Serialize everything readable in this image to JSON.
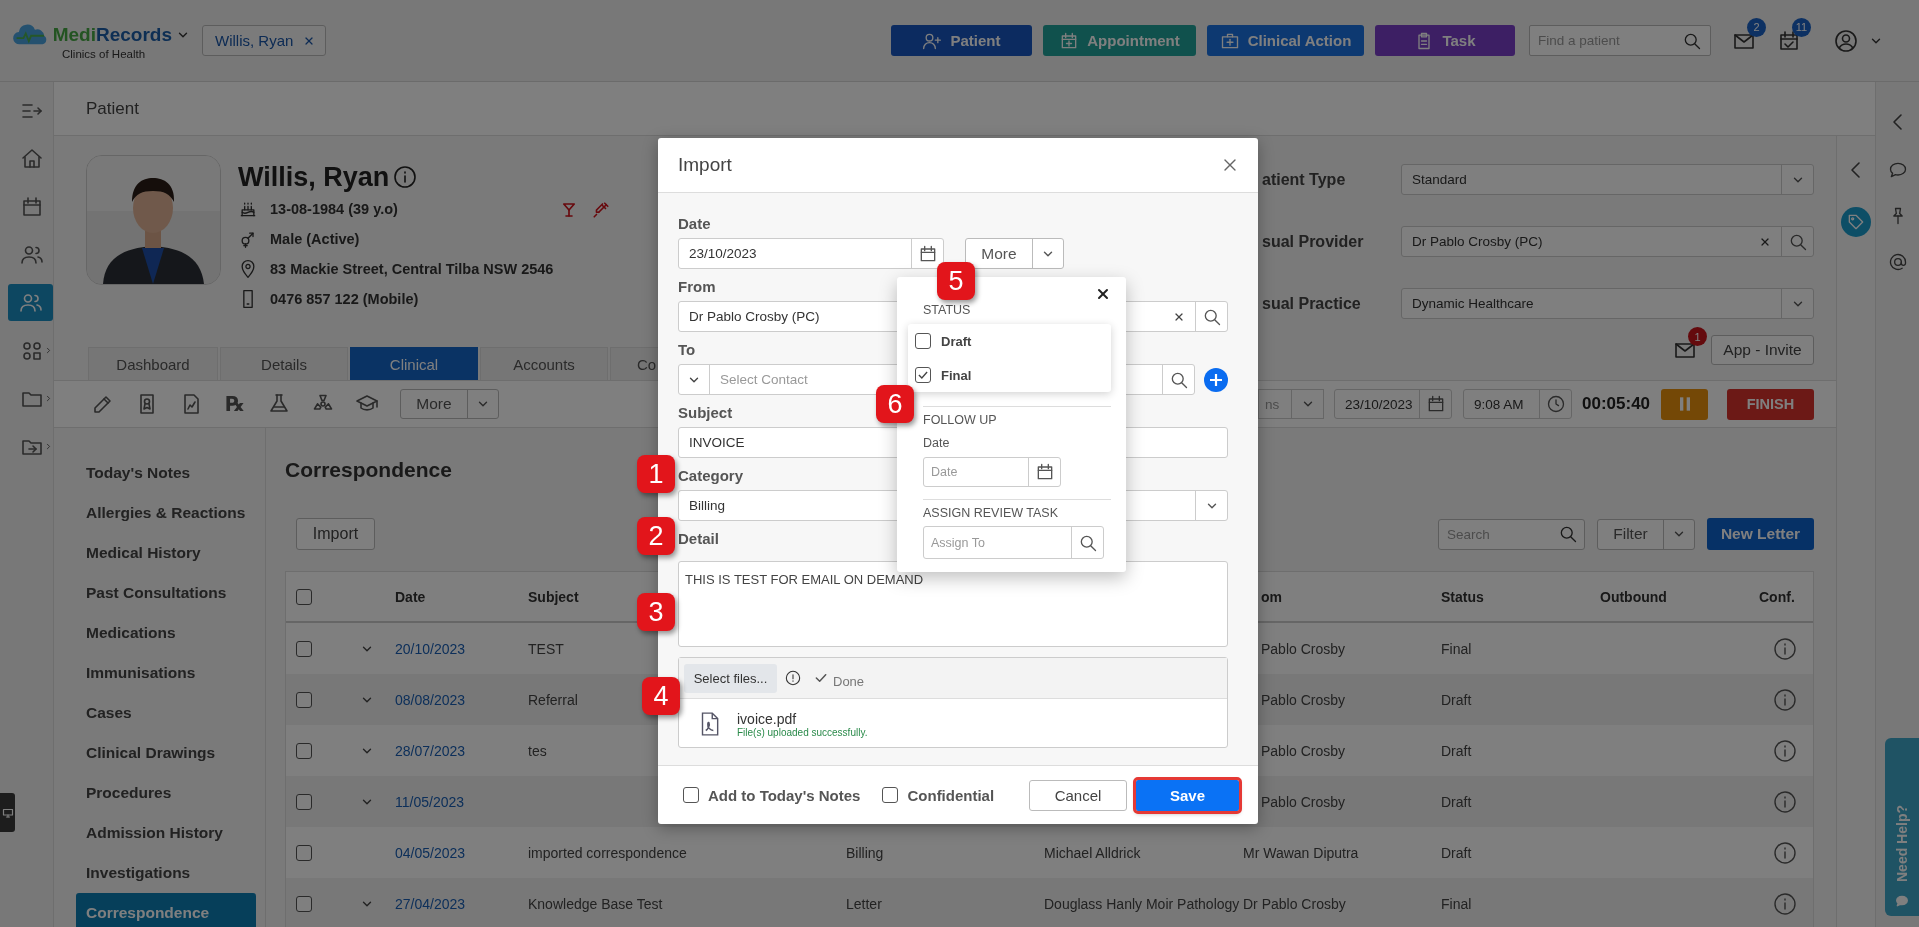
{
  "app": {
    "brand_parts": [
      "Medi",
      "Records"
    ],
    "org": "Clinics of Health"
  },
  "patient_chip": {
    "label": "Willis, Ryan"
  },
  "action_buttons": [
    {
      "label": "Patient",
      "kind": "patient"
    },
    {
      "label": "Appointment",
      "kind": "appointment"
    },
    {
      "label": "Clinical Action",
      "kind": "clinical"
    },
    {
      "label": "Task",
      "kind": "task"
    }
  ],
  "search": {
    "placeholder": "Find a patient"
  },
  "notifications": [
    {
      "kind": "mail",
      "count": "2"
    },
    {
      "kind": "calendar",
      "count": "11"
    }
  ],
  "left_rail": [
    {
      "kind": "expand",
      "selected": false,
      "submenu": false
    },
    {
      "kind": "home",
      "selected": false,
      "submenu": false
    },
    {
      "kind": "calendar",
      "selected": false,
      "submenu": false
    },
    {
      "kind": "people",
      "selected": false,
      "submenu": false
    },
    {
      "kind": "patients",
      "selected": true,
      "submenu": false
    },
    {
      "kind": "apps",
      "selected": false,
      "submenu": true
    },
    {
      "kind": "folder",
      "selected": false,
      "submenu": true
    },
    {
      "kind": "folder_share",
      "selected": false,
      "submenu": true
    }
  ],
  "page_title": "Patient",
  "patient": {
    "name": "Willis, Ryan",
    "details": [
      {
        "kind": "dob",
        "text": "13-08-1984 (39 y.o)"
      },
      {
        "kind": "sex",
        "text": "Male (Active)"
      },
      {
        "kind": "address",
        "text": "83 Mackie Street, Central Tilba NSW 2546"
      },
      {
        "kind": "phone",
        "text": "0476 857 122 (Mobile)"
      }
    ],
    "alerts": [
      {
        "kind": "alcohol"
      },
      {
        "kind": "drug"
      }
    ]
  },
  "patient_fields": [
    {
      "label": "atient Type",
      "value": "Standard",
      "kind": "select"
    },
    {
      "label": "sual Provider",
      "value": "Dr Pablo Crosby (PC)",
      "kind": "lookup"
    },
    {
      "label": "sual Practice",
      "value": "Dynamic Healthcare",
      "kind": "select"
    }
  ],
  "invite": {
    "unread": "1",
    "label": "App - Invite"
  },
  "tabs": [
    {
      "label": "Dashboard",
      "selected": false
    },
    {
      "label": "Details",
      "selected": false
    },
    {
      "label": "Clinical",
      "selected": true
    },
    {
      "label": "Accounts",
      "selected": false
    },
    {
      "label": "Co",
      "selected": false
    }
  ],
  "toolbar": {
    "tools": [
      {
        "kind": "edit"
      },
      {
        "kind": "certificate"
      },
      {
        "kind": "chart"
      },
      {
        "kind": "glyph",
        "glyph": "℞"
      },
      {
        "kind": "lab"
      },
      {
        "kind": "radiation"
      },
      {
        "kind": "education"
      }
    ],
    "more": "More"
  },
  "encounter": {
    "type_value": "ns",
    "date": "23/10/2023",
    "time": "9:08 AM",
    "timer": "00:05:40",
    "finish": "FINISH"
  },
  "subnav": [
    {
      "label": "Today's Notes",
      "selected": false
    },
    {
      "label": "Allergies & Reactions",
      "selected": false
    },
    {
      "label": "Medical History",
      "selected": false
    },
    {
      "label": "Past Consultations",
      "selected": false
    },
    {
      "label": "Medications",
      "selected": false
    },
    {
      "label": "Immunisations",
      "selected": false
    },
    {
      "label": "Cases",
      "selected": false
    },
    {
      "label": "Clinical Drawings",
      "selected": false
    },
    {
      "label": "Procedures",
      "selected": false
    },
    {
      "label": "Admission History",
      "selected": false
    },
    {
      "label": "Investigations",
      "selected": false
    },
    {
      "label": "Correspondence",
      "selected": true
    }
  ],
  "correspondence": {
    "title": "Correspondence",
    "import": "Import",
    "search_placeholder": "Search",
    "filter": "Filter",
    "new_letter": "New Letter",
    "all_checked": false,
    "headers": {
      "date": "Date",
      "subject": "Subject",
      "from": "om",
      "status": "Status",
      "outbound": "Outbound",
      "conf": "Conf."
    },
    "rows": [
      {
        "checked": false,
        "expandable": true,
        "date": "20/10/2023",
        "subject": "TEST",
        "from": "Pablo Crosby",
        "status": "Final"
      },
      {
        "checked": false,
        "expandable": true,
        "date": "08/08/2023",
        "subject": "Referral",
        "from": "Pablo Crosby",
        "status": "Draft"
      },
      {
        "checked": false,
        "expandable": true,
        "date": "28/07/2023",
        "subject": "tes",
        "from": "Pablo Crosby",
        "status": "Draft"
      },
      {
        "checked": false,
        "expandable": true,
        "date": "11/05/2023",
        "from": "Pablo Crosby",
        "status": "Draft"
      },
      {
        "checked": false,
        "expandable": false,
        "date": "04/05/2023",
        "subject": "imported correspondence",
        "category": "Billing",
        "column_5": "Michael Alldrick",
        "from": "Mr Wawan Diputra",
        "status": "Draft"
      },
      {
        "checked": false,
        "expandable": true,
        "date": "27/04/2023",
        "subject": "Knowledge Base Test",
        "category": "Letter",
        "column_5": "Douglass Hanly Moir Pathology",
        "from": "Dr Pablo Crosby",
        "status": "Final"
      }
    ]
  },
  "import_dialog": {
    "title": "Import",
    "date_label": "Date",
    "date": "23/10/2023",
    "more": "More",
    "from_label": "From",
    "from": "Dr Pablo Crosby (PC)",
    "to_label": "To",
    "to_placeholder": "Select Contact",
    "subject_label": "Subject",
    "subject": "INVOICE",
    "category_label": "Category",
    "category": "Billing",
    "detail_label": "Detail",
    "detail": "THIS IS TEST FOR EMAIL ON DEMAND",
    "select_files": "Select files...",
    "upload_state": "Done",
    "files": [
      {
        "name": "ivoice.pdf",
        "message": "File(s) uploaded successfully."
      }
    ],
    "options": [
      {
        "label": "Add to Today's Notes",
        "checked": false
      },
      {
        "label": "Confidential",
        "checked": false
      }
    ],
    "cancel": "Cancel",
    "save": {
      "label": "Save",
      "highlighted": true
    }
  },
  "more_popover": {
    "status_label": "STATUS",
    "statuses": [
      {
        "label": "Draft",
        "checked": false
      },
      {
        "label": "Final",
        "checked": true
      }
    ],
    "follow_up_label": "FOLLOW UP",
    "date_label": "Date",
    "date_placeholder": "Date",
    "assign_label": "ASSIGN REVIEW TASK",
    "assign_placeholder": "Assign To"
  },
  "callouts": [
    {
      "number": "1"
    },
    {
      "number": "2"
    },
    {
      "number": "3"
    },
    {
      "number": "4"
    },
    {
      "number": "5"
    },
    {
      "number": "6"
    }
  ],
  "help_tab": {
    "label": "Need Help?"
  }
}
